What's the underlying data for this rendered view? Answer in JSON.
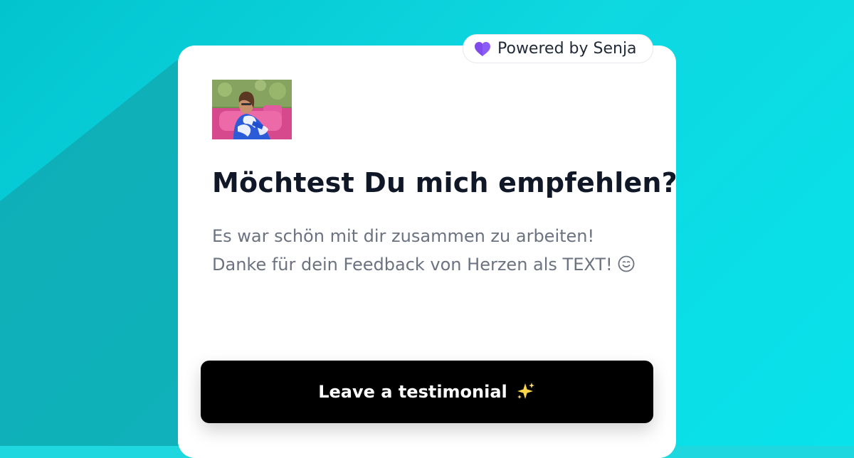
{
  "badge": {
    "icon": "purple-heart-icon",
    "label": "Powered by Senja"
  },
  "card": {
    "avatar": "profile-photo",
    "title": "Möchtest Du mich empfehlen?",
    "message": {
      "line1": "Es war schön mit dir zusammen zu arbeiten!",
      "line2": "Danke für dein Feedback von Herzen als TEXT!",
      "emoji": "smiling-face-icon"
    },
    "button": {
      "label": "Leave a testimonial",
      "icon": "sparkles-icon"
    }
  },
  "colors": {
    "background": "#1fd7df",
    "card": "#ffffff",
    "button": "#000000",
    "title": "#101828",
    "body_text": "#6b7280",
    "heart": "#8b5cf6"
  }
}
